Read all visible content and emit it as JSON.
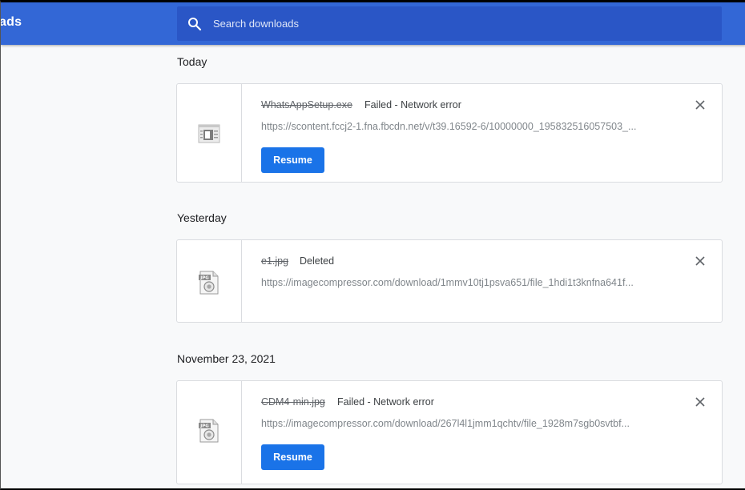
{
  "toolbar": {
    "title": "ads",
    "search_placeholder": "Search downloads"
  },
  "sections": [
    {
      "date": "Today",
      "items": [
        {
          "file_name": "WhatsAppSetup.exe",
          "status": "Failed - Network error",
          "url": "https://scontent.fccj2-1.fna.fbcdn.net/v/t39.16592-6/10000000_195832516057503_...",
          "icon": "exe-file-icon",
          "action_label": "Resume"
        }
      ]
    },
    {
      "date": "Yesterday",
      "items": [
        {
          "file_name": "e1.jpg",
          "status": "Deleted",
          "url": "https://imagecompressor.com/download/1mmv10tj1psva651/file_1hdi1t3knfna641f...",
          "icon": "jpg-file-icon"
        }
      ]
    },
    {
      "date": "November 23, 2021",
      "items": [
        {
          "file_name": "CDM4-min.jpg",
          "status": "Failed - Network error",
          "url": "https://imagecompressor.com/download/267l4l1jmm1qchtv/file_1928m7sgb0svtbf...",
          "icon": "jpg-file-icon",
          "action_label": "Resume"
        }
      ]
    }
  ],
  "colors": {
    "toolbar": "#3367d6",
    "search": "#2a56c6",
    "button": "#1a73e8",
    "page_bg": "#f8f9fa"
  }
}
